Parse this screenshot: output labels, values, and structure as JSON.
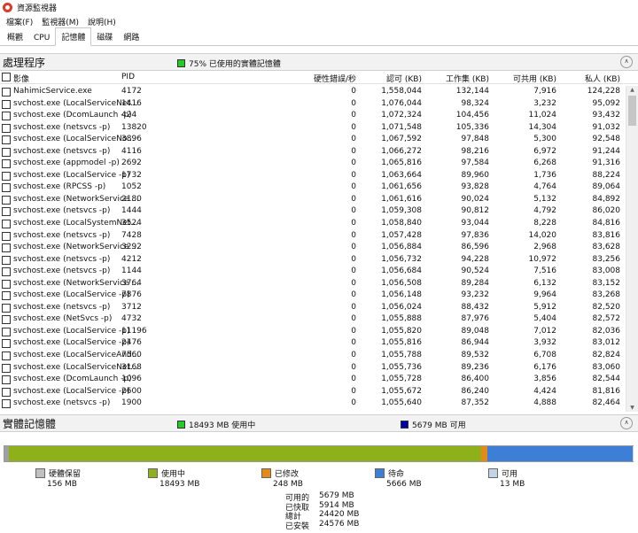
{
  "window": {
    "title": "資源監視器"
  },
  "menu": [
    "檔案(F)",
    "監視器(M)",
    "說明(H)"
  ],
  "tabs": [
    {
      "label": "概觀",
      "active": false
    },
    {
      "label": "CPU",
      "active": false
    },
    {
      "label": "記憶體",
      "active": true
    },
    {
      "label": "磁碟",
      "active": false
    },
    {
      "label": "網路",
      "active": false
    }
  ],
  "processes": {
    "title": "處理程序",
    "summary": "75% 已使用的實體記憶體",
    "summary_color": "#22cc22",
    "columns": {
      "image": "影像",
      "pid": "PID",
      "hard_faults": "硬性錯誤/秒",
      "commit": "認可 (KB)",
      "working_set": "工作集 (KB)",
      "shareable": "可共用 (KB)",
      "private": "私人 (KB)"
    },
    "rows": [
      [
        "NahimicService.exe",
        "4172",
        "0",
        "1,558,044",
        "132,144",
        "7,916",
        "124,228"
      ],
      [
        "svchost.exe (LocalServiceNet...",
        "1416",
        "0",
        "1,076,044",
        "98,324",
        "3,232",
        "95,092"
      ],
      [
        "svchost.exe (DcomLaunch -p)",
        "424",
        "0",
        "1,072,324",
        "104,456",
        "11,024",
        "93,432"
      ],
      [
        "svchost.exe (netsvcs -p)",
        "13820",
        "0",
        "1,071,548",
        "105,336",
        "14,304",
        "91,032"
      ],
      [
        "svchost.exe (LocalServiceNo...",
        "3896",
        "0",
        "1,067,592",
        "97,848",
        "5,300",
        "92,548"
      ],
      [
        "svchost.exe (netsvcs -p)",
        "4116",
        "0",
        "1,066,272",
        "98,216",
        "6,972",
        "91,244"
      ],
      [
        "svchost.exe (appmodel -p)",
        "2692",
        "0",
        "1,065,816",
        "97,584",
        "6,268",
        "91,316"
      ],
      [
        "svchost.exe (LocalService -p)",
        "1732",
        "0",
        "1,063,664",
        "89,960",
        "1,736",
        "88,224"
      ],
      [
        "svchost.exe (RPCSS -p)",
        "1052",
        "0",
        "1,061,656",
        "93,828",
        "4,764",
        "89,064"
      ],
      [
        "svchost.exe (NetworkService ...",
        "2180",
        "0",
        "1,061,616",
        "90,024",
        "5,132",
        "84,892"
      ],
      [
        "svchost.exe (netsvcs -p)",
        "1444",
        "0",
        "1,059,308",
        "90,812",
        "4,792",
        "86,020"
      ],
      [
        "svchost.exe (LocalSystemNet...",
        "3524",
        "0",
        "1,058,840",
        "93,044",
        "8,228",
        "84,816"
      ],
      [
        "svchost.exe (netsvcs -p)",
        "7428",
        "0",
        "1,057,428",
        "97,836",
        "14,020",
        "83,816"
      ],
      [
        "svchost.exe (NetworkService ...",
        "3292",
        "0",
        "1,056,884",
        "86,596",
        "2,968",
        "83,628"
      ],
      [
        "svchost.exe (netsvcs -p)",
        "4212",
        "0",
        "1,056,732",
        "94,228",
        "10,972",
        "83,256"
      ],
      [
        "svchost.exe (netsvcs -p)",
        "1144",
        "0",
        "1,056,684",
        "90,524",
        "7,516",
        "83,008"
      ],
      [
        "svchost.exe (NetworkService ...",
        "3764",
        "0",
        "1,056,508",
        "89,284",
        "6,132",
        "83,152"
      ],
      [
        "svchost.exe (LocalService -p)",
        "7876",
        "0",
        "1,056,148",
        "93,232",
        "9,964",
        "83,268"
      ],
      [
        "svchost.exe (netsvcs -p)",
        "3712",
        "0",
        "1,056,024",
        "88,432",
        "5,912",
        "82,520"
      ],
      [
        "svchost.exe (NetSvcs -p)",
        "4732",
        "0",
        "1,055,888",
        "87,976",
        "5,404",
        "82,572"
      ],
      [
        "svchost.exe (LocalService -p)",
        "11196",
        "0",
        "1,055,820",
        "89,048",
        "7,012",
        "82,036"
      ],
      [
        "svchost.exe (LocalService -p)",
        "2476",
        "0",
        "1,055,816",
        "86,944",
        "3,932",
        "83,012"
      ],
      [
        "svchost.exe (LocalServiceAnd...",
        "7560",
        "0",
        "1,055,788",
        "89,532",
        "6,708",
        "82,824"
      ],
      [
        "svchost.exe (LocalServiceNet...",
        "3168",
        "0",
        "1,055,736",
        "89,236",
        "6,176",
        "83,060"
      ],
      [
        "svchost.exe (DcomLaunch -p)",
        "1096",
        "0",
        "1,055,728",
        "86,400",
        "3,856",
        "82,544"
      ],
      [
        "svchost.exe (LocalService -p)",
        "2600",
        "0",
        "1,055,672",
        "86,240",
        "4,424",
        "81,816"
      ],
      [
        "svchost.exe (netsvcs -p)",
        "1900",
        "0",
        "1,055,640",
        "87,352",
        "4,888",
        "82,464"
      ]
    ]
  },
  "physical_memory": {
    "title": "實體記憶體",
    "in_use_summary": "18493 MB 使用中",
    "in_use_color": "#22cc22",
    "available_summary": "5679 MB 可用",
    "available_color": "#0000aa",
    "bar": [
      {
        "name": "硬體保留",
        "value_mb": 156,
        "color": "#a0a0a0"
      },
      {
        "name": "使用中",
        "value_mb": 18493,
        "color": "#8db01b"
      },
      {
        "name": "已修改",
        "value_mb": 248,
        "color": "#e58a16"
      },
      {
        "name": "待命",
        "value_mb": 5666,
        "color": "#3d7fd6"
      },
      {
        "name": "可用",
        "value_mb": 13,
        "color": "#c3d3ea"
      }
    ],
    "legend": [
      {
        "label": "硬體保留",
        "value": "156 MB",
        "color": "#c0c0c0"
      },
      {
        "label": "使用中",
        "value": "18493 MB",
        "color": "#8db01b"
      },
      {
        "label": "已修改",
        "value": "248 MB",
        "color": "#e58a16"
      },
      {
        "label": "待命",
        "value": "5666 MB",
        "color": "#3d7fd6"
      },
      {
        "label": "可用",
        "value": "13 MB",
        "color": "#c3d3ea"
      }
    ],
    "stats": [
      {
        "label": "可用的",
        "value": "5679 MB"
      },
      {
        "label": "已快取",
        "value": "5914 MB"
      },
      {
        "label": "總計",
        "value": "24420 MB"
      },
      {
        "label": "已安裝",
        "value": "24576 MB"
      }
    ]
  }
}
